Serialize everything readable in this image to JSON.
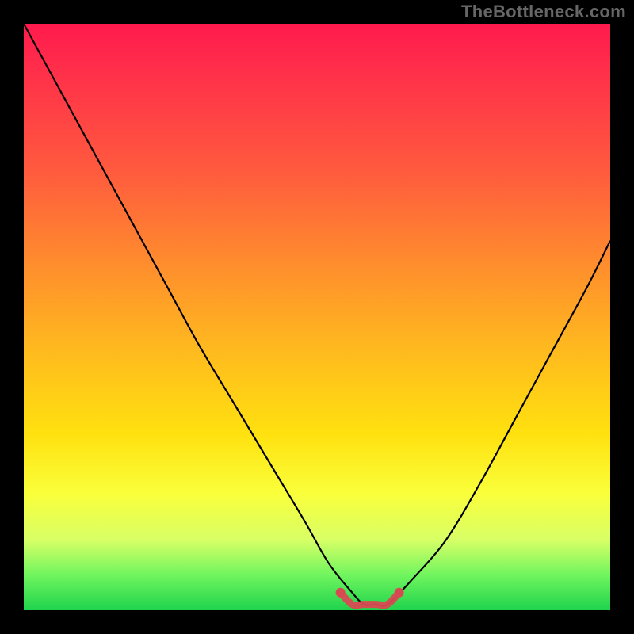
{
  "watermark": "TheBottleneck.com",
  "colors": {
    "background": "#000000",
    "gradient_top": "#ff1a4d",
    "gradient_mid": "#ffe10f",
    "gradient_bottom": "#1fd34d",
    "curve": "#000000",
    "marker": "#d84a52"
  },
  "chart_data": {
    "type": "line",
    "title": "",
    "xlabel": "",
    "ylabel": "",
    "xlim": [
      0,
      100
    ],
    "ylim": [
      0,
      100
    ],
    "grid": false,
    "legend": false,
    "annotations": [
      "TheBottleneck.com"
    ],
    "series": [
      {
        "name": "bottleneck-curve",
        "x": [
          0,
          6,
          12,
          18,
          24,
          30,
          36,
          42,
          48,
          52,
          56,
          58,
          60,
          62,
          66,
          72,
          78,
          84,
          90,
          96,
          100
        ],
        "values": [
          100,
          89,
          78,
          67,
          56,
          45,
          35,
          25,
          15,
          8,
          3,
          1,
          1,
          1,
          5,
          12,
          22,
          33,
          44,
          55,
          63
        ]
      },
      {
        "name": "sweet-spot-marker",
        "x": [
          54,
          56,
          58,
          60,
          62,
          64
        ],
        "values": [
          3,
          1,
          1,
          1,
          1,
          3
        ]
      }
    ]
  }
}
